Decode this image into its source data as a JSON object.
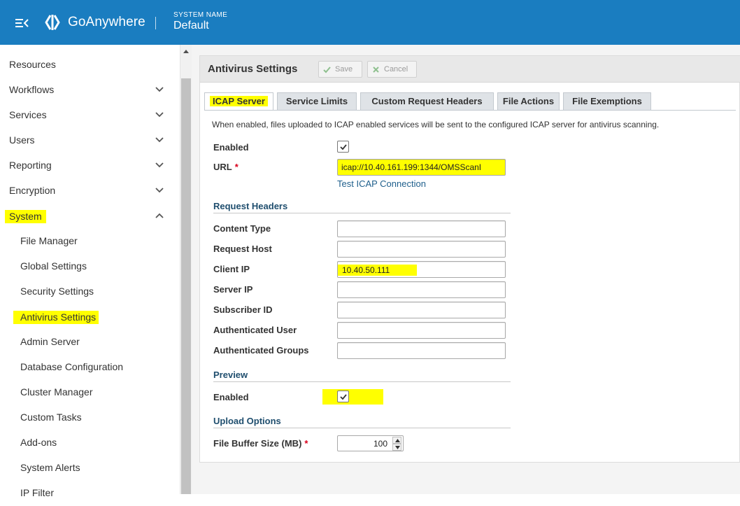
{
  "header": {
    "app_name": "GoAnywhere",
    "system_label": "SYSTEM NAME",
    "system_value": "Default"
  },
  "sidebar": {
    "items": [
      {
        "label": "Resources"
      },
      {
        "label": "Workflows"
      },
      {
        "label": "Services"
      },
      {
        "label": "Users"
      },
      {
        "label": "Reporting"
      },
      {
        "label": "Encryption"
      },
      {
        "label": "System"
      }
    ],
    "system_subitems": [
      {
        "label": "File Manager"
      },
      {
        "label": "Global Settings"
      },
      {
        "label": "Security Settings"
      },
      {
        "label": "Antivirus Settings"
      },
      {
        "label": "Admin Server"
      },
      {
        "label": "Database Configuration"
      },
      {
        "label": "Cluster Manager"
      },
      {
        "label": "Custom Tasks"
      },
      {
        "label": "Add-ons"
      },
      {
        "label": "System Alerts"
      },
      {
        "label": "IP Filter"
      }
    ]
  },
  "panel": {
    "title": "Antivirus Settings",
    "save_label": "Save",
    "cancel_label": "Cancel",
    "tabs": [
      {
        "label": "ICAP Server"
      },
      {
        "label": "Service Limits"
      },
      {
        "label": "Custom Request Headers"
      },
      {
        "label": "File Actions"
      },
      {
        "label": "File Exemptions"
      }
    ],
    "intro": "When enabled, files uploaded to ICAP enabled services will be sent to the configured ICAP server for antivirus scanning."
  },
  "form": {
    "enabled_label": "Enabled",
    "enabled_checked": true,
    "url_label": "URL",
    "url_value": "icap://10.40.161.199:1344/OMSScanI",
    "required_marker": "*",
    "test_link": "Test ICAP Connection",
    "request_headers_title": "Request Headers",
    "content_type_label": "Content Type",
    "content_type_value": "",
    "request_host_label": "Request Host",
    "request_host_value": "",
    "client_ip_label": "Client IP",
    "client_ip_value": "10.40.50.111",
    "server_ip_label": "Server IP",
    "server_ip_value": "",
    "subscriber_id_label": "Subscriber ID",
    "subscriber_id_value": "",
    "auth_user_label": "Authenticated User",
    "auth_user_value": "",
    "auth_groups_label": "Authenticated Groups",
    "auth_groups_value": "",
    "preview_title": "Preview",
    "preview_enabled_label": "Enabled",
    "preview_enabled_checked": true,
    "upload_options_title": "Upload Options",
    "file_buffer_label": "File Buffer Size (MB)",
    "file_buffer_value": "100"
  },
  "colors": {
    "header_bg": "#1a7dc0",
    "highlight": "#ffff00",
    "section_title": "#1f4e6e",
    "link": "#1f5f8c",
    "required": "#d9001b"
  },
  "icons": [
    "menu-collapse-icon",
    "goanywhere-logo-icon",
    "chevron-down-icon",
    "chevron-up-icon",
    "checkmark-icon",
    "x-icon",
    "scroll-up-arrow-icon",
    "spinner-up-icon",
    "spinner-down-icon"
  ]
}
